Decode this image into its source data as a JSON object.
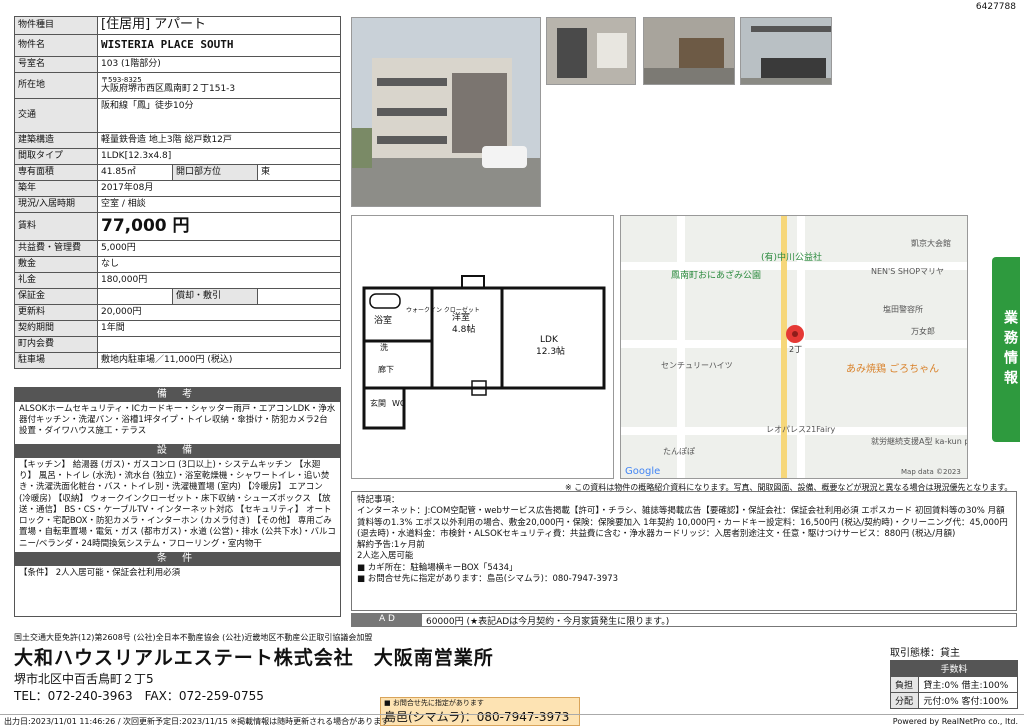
{
  "doc_id": "6427788",
  "spec": {
    "type_label": "物件種目",
    "type_value": "[住居用] アパート",
    "name_label": "物件名",
    "name_value": "WISTERIA PLACE SOUTH",
    "room_label": "号室名",
    "room_value": "103 (1階部分)",
    "address_label": "所在地",
    "zip": "〒593-8325",
    "address": "大阪府堺市西区鳳南町２丁151-3",
    "traffic_label": "交通",
    "traffic_value": "阪和線「鳳」徒歩10分",
    "structure_label": "建築構造",
    "structure_value": "軽量鉄骨造 地上3階 総戸数12戸",
    "layout_label": "間取タイプ",
    "layout_value": "1LDK[12.3x4.8]",
    "area_label": "専有面積",
    "area_value": "41.85㎡",
    "opening_label": "開口部方位",
    "opening_value": "東",
    "built_label": "築年",
    "built_value": "2017年08月",
    "status_label": "現況/入居時期",
    "status_value": "空室 / 相談",
    "rent_label": "賃料",
    "rent_value": "77,000 円",
    "mgmt_label": "共益費・管理費",
    "mgmt_value": "5,000円",
    "deposit_label": "敷金",
    "deposit_value": "なし",
    "keymoney_label": "礼金",
    "keymoney_value": "180,000円",
    "guarantee_label": "保証金",
    "guarantee_value": "",
    "amort_label": "償却・敷引",
    "amort_value": "",
    "renewal_label": "更新料",
    "renewal_value": "20,000円",
    "contract_label": "契約期間",
    "contract_value": "1年間",
    "association_label": "町内会費",
    "association_value": "",
    "parking_label": "駐車場",
    "parking_value": "敷地内駐車場／11,000円 (税込)"
  },
  "bikou": {
    "header": "備 考",
    "text": "ALSOKホームセキュリティ・ICカードキー・シャッター雨戸・エアコンLDK・浄水器付キッチン・洗濯パン・浴槽1坪タイプ・トイレ収納・傘掛け・防犯カメラ2台設置・ダイワハウス施工・テラス"
  },
  "setsubi": {
    "header": "設 備",
    "text": "【キッチン】 給湯器 (ガス)・ガスコンロ (3口以上)・システムキッチン 【水廻り】 風呂・トイレ (水洗)・流水台 (独立)・浴室乾燥機・シャワートイレ・追い焚き・洗濯洗面化粧台・バス・トイレ別・洗濯機置場 (室内) 【冷暖房】 エアコン (冷暖房) 【収納】 ウォークインクローゼット・床下収納・シューズボックス 【放送・通信】 BS・CS・ケーブルTV・インターネット対応 【セキュリティ】 オートロック・宅配BOX・防犯カメラ・インターホン (カメラ付き) 【その他】 専用ごみ置場・自転車置場・電気・ガス (都市ガス)・水道 (公営)・排水 (公共下水)・バルコニー/ベランダ・24時間換気システム・フローリング・室内物干"
  },
  "jouken": {
    "header": "条 件",
    "text": "【条件】 2人入居可能・保証会社利用必須"
  },
  "plan": {
    "rooms": [
      "浴室",
      "洋室",
      "4.8帖",
      "LDK",
      "12.3帖",
      "ウォークイン クローゼット",
      "洗",
      "廊下",
      "玄関",
      "WC"
    ]
  },
  "map": {
    "labels": [
      "(有)中川公益社",
      "鳳南町おにあざみ公園",
      "凱京大会館",
      "NEN'S SHOPマリヤ",
      "塩田警容所",
      "万女郎",
      "2丁",
      "センチュリーハイツ",
      "あみ焼鶏 ごろちゃん",
      "レオパレス21Fairy",
      "たんぽぽ",
      "就労継続支援A型 ka-kun project",
      "Google",
      "Map data ©2023"
    ]
  },
  "side_tab": "業務情報",
  "disclaimer": "※ この資料は物件の概略紹介資料になります。写真、間取図面、設備、概要などが現況と異なる場合は現況優先となります。",
  "remarks": {
    "title": "特記事項：",
    "lines": [
      "インターネット：J:COM空配管・webサービス広告掲載【許可】・チラシ、雑誌等掲載広告【要確認】・保証会社：保証会社利用必須 エポスカード 初回賃料等の30% 月額賃料等の1.3% エポス以外利用の場合、敷金20,000円・保険：保険要加入 1年契約 10,000円・カードキー設定料：16,500円 (税込/契約時)・クリーニング代：45,000円 (退去時)・水道料金：市検針・ALSOKセキュリティ費：共益費に含む・浄水器カードリッジ：入居者別途注文・任意・駆けつけサービス：880円 (税込/月額)",
      "解約予告:1ヶ月前",
      "2人迄入居可能",
      "■ カギ所在：駐輪場横キーBOX「5434」",
      "■ お問合せ先に指定があります：島邑(シマムラ)：080-7947-3973"
    ]
  },
  "ad": {
    "label": "A D",
    "value": "60000円 (★表記ADは今月契約・今月家賃発生に限ります。)"
  },
  "company": {
    "license": "国土交通大臣免許(12)第2608号 (公社)全日本不動産協会 (公社)近畿地区不動産公正取引協議会加盟",
    "name": "大和ハウスリアルエステート株式会社　大阪南営業所",
    "address": "堺市北区中百舌鳥町２丁5",
    "tel": "TEL：072-240-3963　FAX：072-259-0755"
  },
  "contact": {
    "small": "■ お問合せ先に指定があります",
    "main": "島邑(シマムラ)：080-7947-3973"
  },
  "fees": {
    "mode_label": "取引態様：",
    "mode_value": "貸主",
    "header": "手数料",
    "row1_label": "負担",
    "row1_value": "貸主:0% 借主:100%",
    "row2_label": "分配",
    "row2_value": "元付:0% 客付:100%"
  },
  "footer": {
    "left": "出力日:2023/11/01 11:46:26 / 次回更新予定日:2023/11/15 ※掲載情報は随時更新される場合があります",
    "right": "Powered by RealNetPro co., ltd."
  }
}
